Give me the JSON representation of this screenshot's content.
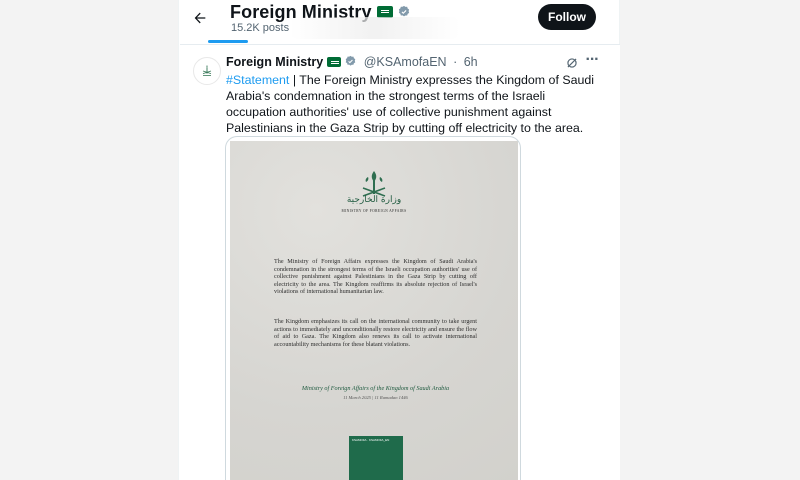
{
  "header": {
    "title": "Foreign Ministry",
    "posts_count": "15.2K posts",
    "follow_label": "Follow"
  },
  "tweet": {
    "author_name": "Foreign Ministry",
    "handle": "@KSAmofaEN",
    "separator": "·",
    "time": "6h",
    "hashtag": "#Statement",
    "text": " | The Foreign Ministry expresses the Kingdom of Saudi Arabia's condemnation in the strongest terms of the Israeli occupation authorities' use of collective punishment against Palestinians in the Gaza Strip by cutting off electricity to the area."
  },
  "document": {
    "ministry_ar": "وزارة الخارجية",
    "ministry_en": "MINISTRY OF FOREIGN AFFAIRS",
    "paragraph1": "The Ministry of Foreign Affairs expresses the Kingdom of Saudi Arabia's condemnation in the strongest terms of the Israeli occupation authorities' use of collective punishment against Palestinians in the Gaza Strip by cutting off electricity to the area. The Kingdom reaffirms its absolute rejection of Israel's violations of international humanitarian law.",
    "paragraph2": "The Kingdom emphasizes its call on the international community to take urgent actions to immediately and unconditionally restore electricity and ensure the flow of aid to Gaza. The Kingdom also renews its call to activate international accountability mechanisms for these blatant violations.",
    "signature": "Ministry of Foreign Affairs of the Kingdom of Saudi Arabia",
    "date": "11 March 2025 | 11 Ramadan 1446",
    "qr_text": "KSAMOFA · KSAMOFA_EN"
  },
  "colors": {
    "brand_blue": "#1d9bf0",
    "saudi_green": "#006c35",
    "doc_green": "#1f6b4b"
  },
  "icons": {
    "back": "arrow-left-icon",
    "verified": "verified-badge-icon",
    "flag": "saudi-flag-icon",
    "grok": "grok-icon",
    "more": "more-icon"
  }
}
